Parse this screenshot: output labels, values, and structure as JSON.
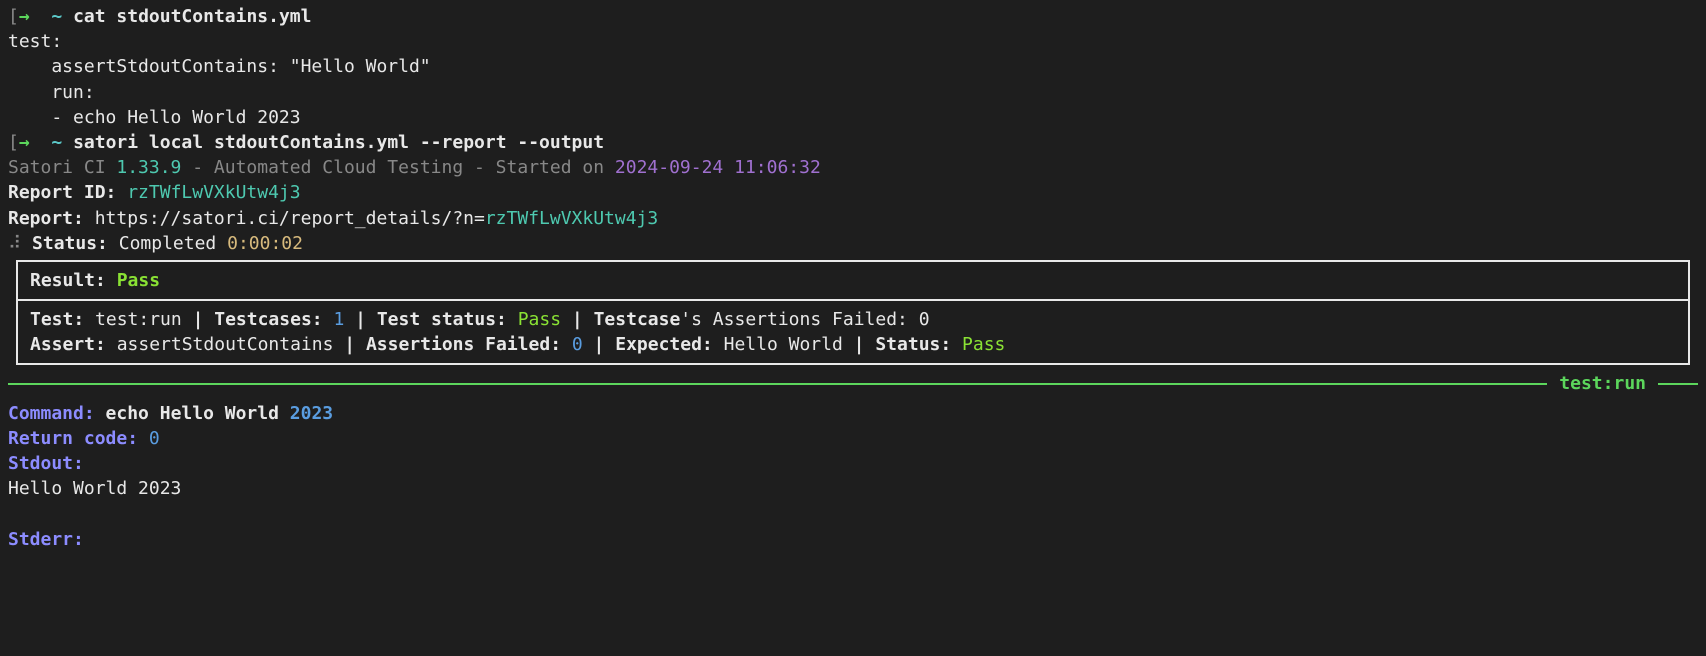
{
  "prompt1": {
    "arrow": "→",
    "tilde": "~",
    "cmd": "cat stdoutContains.yml"
  },
  "yaml": {
    "l1": "test:",
    "l2": "    assertStdoutContains: \"Hello World\"",
    "l3": "    run:",
    "l4": "    - echo Hello World 2023"
  },
  "prompt2": {
    "arrow": "→",
    "tilde": "~",
    "cmd": "satori local stdoutContains.yml --report --output"
  },
  "header": {
    "product": "Satori CI ",
    "version": "1.33.9",
    "desc": " - Automated Cloud Testing - Started on ",
    "date": "2024-09-24",
    "time": " 11:06:32"
  },
  "report": {
    "id_label": "Report ID: ",
    "id_value": "rzTWfLwVXkUtw4j3",
    "url_label": "Report: ",
    "url_base": "https://satori.ci/report_details/?n=",
    "url_id": "rzTWfLwVXkUtw4j3"
  },
  "status": {
    "dots": "⠼",
    "label": " Status: ",
    "value": "Completed ",
    "time": "0:00:02"
  },
  "result": {
    "label": "Result: ",
    "value": "Pass"
  },
  "test": {
    "test_label": "Test: ",
    "test_value": "test:run",
    "sep": " | ",
    "tc_label": "Testcases: ",
    "tc_value": "1",
    "ts_label": "Test status: ",
    "ts_value": "Pass",
    "taf_label_1": "Testcase",
    "taf_label_2": "'s Assertions Failed: ",
    "taf_value": "0"
  },
  "assert": {
    "label": "Assert: ",
    "value": "assertStdoutContains",
    "sep": " | ",
    "af_label": "Assertions Failed: ",
    "af_value": "0",
    "exp_label": "Expected: ",
    "exp_value": "Hello World",
    "st_label": "Status: ",
    "st_value": "Pass"
  },
  "rule": {
    "label": " test:",
    "label2": "run "
  },
  "run": {
    "cmd_label": "Command: ",
    "cmd_value": "echo Hello World ",
    "cmd_year": "2023",
    "rc_label": "Return code: ",
    "rc_value": "0",
    "stdout_label": "Stdout:",
    "stdout_value": "Hello World 2023",
    "stderr_label": "Stderr:"
  }
}
